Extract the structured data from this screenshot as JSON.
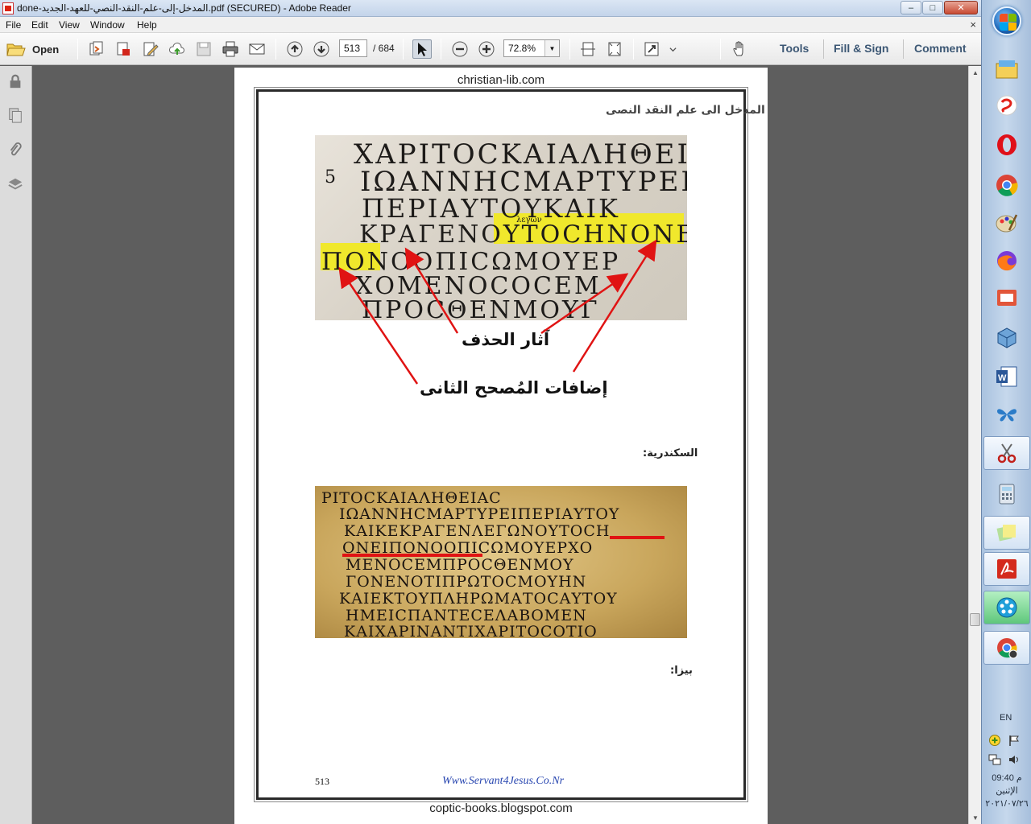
{
  "window": {
    "title": "done-المدخل-إلى-علم-النقد-النصي-للعهد-الجديد.pdf (SECURED) - Adobe Reader",
    "minimize": "–",
    "maximize": "□",
    "close": "✕"
  },
  "menu": {
    "items": [
      "File",
      "Edit",
      "View",
      "Window",
      "Help"
    ],
    "close_doc": "×"
  },
  "toolbar": {
    "open_label": "Open",
    "page_current": "513",
    "page_total": "/ 684",
    "zoom_value": "72.8%",
    "tools_label": "Tools",
    "fill_sign_label": "Fill & Sign",
    "comment_label": "Comment"
  },
  "document": {
    "watermark_top": "christian-lib.com",
    "watermark_bottom": "coptic-books.blogspot.com",
    "header": "المدخل الى علم النقد النصى",
    "manuscript1": {
      "lines": [
        "ΧΑΡΙΤΟϹΚΑΙΑΛΗΘΕΙ",
        "ΙΩΑΝΝΗϹΜΑΡΤΥΡΕΙ",
        "ΠΕΡΙΑΥΤΟΥΚΑΙΚ",
        "ΚΡΑΓΕΝΟΥΤΟϹΗΝΟΝΕΙ",
        "ΠΟΝΟΟΠΙϹΩΜΟΥΕΡ",
        "ΧΟΜΕΝΟϹΟϹΕΜ",
        "ΠΡΟϹΘΕΝΜΟΥΓ"
      ],
      "margin_small": "λεγων",
      "margin_left": "5"
    },
    "annotation_deletion": "آثار الحذف",
    "annotation_corrector": "إضافات المُصحح الثانى",
    "label_alexandrinus": "السكندرية:",
    "manuscript2": {
      "lines": [
        "ΡΙΤΟϹΚΑΙΑΛΗΘΕΙΑϹ",
        "ΙΩΑΝΝΗϹΜΑΡΤΥΡΕΙΠΕΡΙΑΥΤΟΥ",
        "ΚΑΙΚΕΚΡΑΓΕΝΛΕΓΩΝΟΥΤΟϹΗ",
        "ΟΝΕΙΠΟΝΟΟΠΙϹΩΜΟΥΕΡΧΟ",
        "ΜΕΝΟϹΕΜΠΡΟϹΘΕΝΜΟΥ",
        "ΓΟΝΕΝΟΤΙΠΡΩΤΟϹΜΟΥΗΝ",
        "ΚΑΙΕΚΤΟΥΠΛΗΡΩΜΑΤΟϹΑΥΤΟΥ",
        "ΗΜΕΙϹΠΑΝΤΕϹΕΛΑΒΟΜΕΝ",
        "ΚΑΙΧΑΡΙΝΑΝΤΙΧΑΡΙΤΟϹΟΤΙΟ"
      ]
    },
    "label_beza": "بيزا:",
    "page_number": "513",
    "footer_url": "Www.Servant4Jesus.Co.Nr"
  },
  "tray": {
    "language": "EN",
    "time": "09:40 م",
    "day": "الإثنين",
    "date": "٢٠٢١/٠٧/٢٦"
  },
  "colors": {
    "highlight": "#f0e82c",
    "annotation_red": "#e01313",
    "footer_link": "#2846b0",
    "right_tab_text": "#3c5774"
  }
}
